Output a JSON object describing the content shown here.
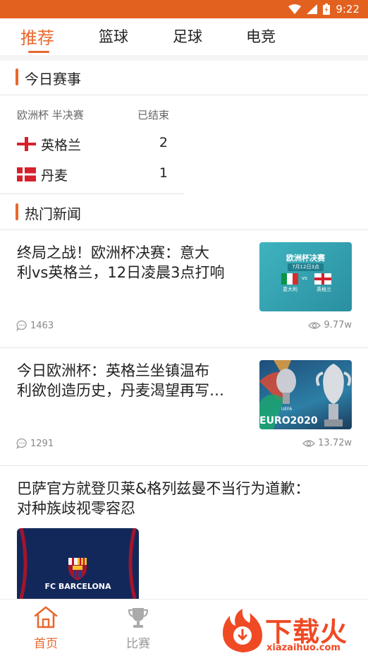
{
  "status_bar": {
    "time": "9:22"
  },
  "tabs": [
    {
      "label": "推荐",
      "active": true
    },
    {
      "label": "篮球",
      "active": false
    },
    {
      "label": "足球",
      "active": false
    },
    {
      "label": "电竞",
      "active": false
    }
  ],
  "today": {
    "section_title": "今日赛事",
    "competition": "欧洲杯 半决赛",
    "status": "已结束",
    "home": {
      "name": "英格兰",
      "score": "2"
    },
    "away": {
      "name": "丹麦",
      "score": "1"
    }
  },
  "hot": {
    "section_title": "热门新闻",
    "items": [
      {
        "title_line1": "终局之战！欧洲杯决赛：意大",
        "title_line2": "利vs英格兰，12日凌晨3点打响",
        "comments": "1463",
        "views": "9.77w",
        "thumb_title": "欧洲杯决赛",
        "thumb_sub": "7月12日3点",
        "thumb_team1": "意大利",
        "thumb_vs": "vs",
        "thumb_team2": "英格兰"
      },
      {
        "title_line1": "今日欧洲杯：英格兰坐镇温布",
        "title_line2": "利欲创造历史，丹麦渴望再写…",
        "comments": "1291",
        "views": "13.72w",
        "thumb_logo_small": "UEFA",
        "thumb_logo": "EURO2020"
      },
      {
        "title_line1": "巴萨官方就登贝莱&格列兹曼不当行为道歉：",
        "title_line2": "对种族歧视零容忍",
        "thumb_logo": "FC BARCELONA"
      }
    ]
  },
  "bottom_nav": [
    {
      "label": "首页",
      "active": true
    },
    {
      "label": "比赛",
      "active": false
    }
  ],
  "watermark": {
    "brand": "下载火",
    "site": "xiazaihuo.com"
  },
  "colors": {
    "accent": "#e8682d",
    "statusbar": "#e2611f"
  }
}
